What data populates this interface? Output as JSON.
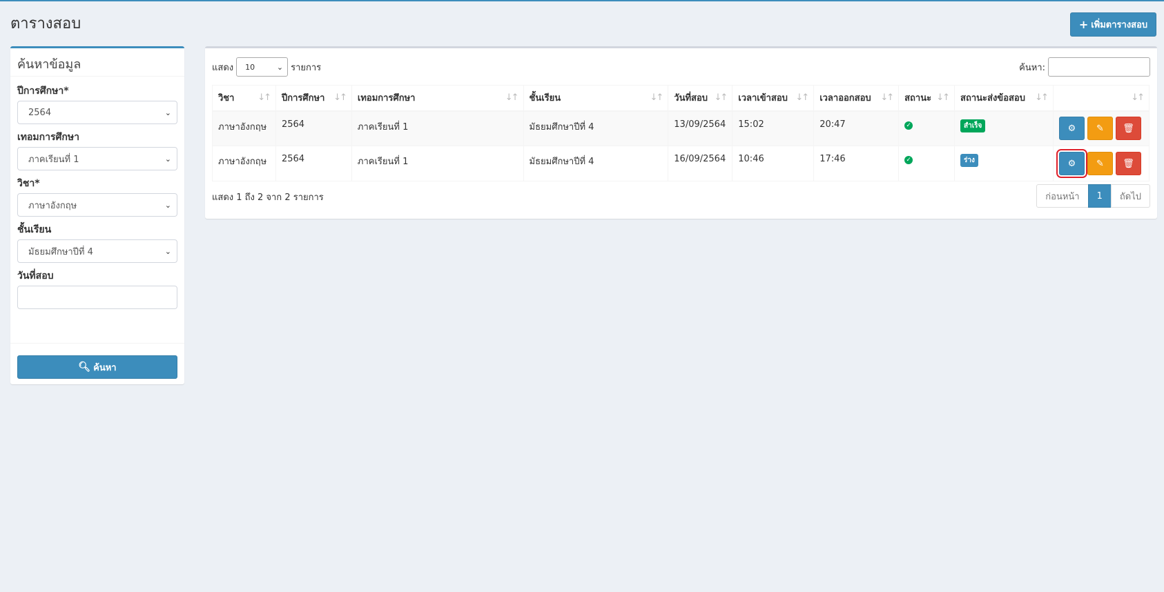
{
  "page": {
    "title": "ตารางสอบ",
    "add_button_label": "เพิ่มตารางสอบ"
  },
  "search_panel": {
    "title": "ค้นหาข้อมูล",
    "fields": {
      "year_label": "ปีการศึกษา*",
      "year_value": "2564",
      "term_label": "เทอมการศึกษา",
      "term_value": "ภาคเรียนที่ 1",
      "subject_label": "วิชา*",
      "subject_value": "ภาษาอังกฤษ",
      "level_label": "ชั้นเรียน",
      "level_value": "มัธยมศึกษาปีที่ 4",
      "date_label": "วันที่สอบ",
      "date_value": ""
    },
    "search_button_label": "ค้นหา"
  },
  "table": {
    "length_prefix": "แสดง",
    "length_value": "10",
    "length_suffix": "รายการ",
    "filter_label": "ค้นหา:",
    "filter_value": "",
    "columns": [
      "วิชา",
      "ปีการศึกษา",
      "เทอมการศึกษา",
      "ชั้นเรียน",
      "วันที่สอบ",
      "เวลาเข้าสอบ",
      "เวลาออกสอบ",
      "สถานะ",
      "สถานะส่งข้อสอบ",
      ""
    ],
    "rows": [
      {
        "subject": "ภาษาอังกฤษ",
        "year": "2564",
        "term": "ภาคเรียนที่ 1",
        "level": "มัธยมศึกษาปีที่ 4",
        "date": "13/09/2564",
        "time_in": "15:02",
        "time_out": "20:47",
        "status_icon": "check-circle-icon",
        "submit_status": "สำเร็จ",
        "submit_color": "#00a65a"
      },
      {
        "subject": "ภาษาอังกฤษ",
        "year": "2564",
        "term": "ภาคเรียนที่ 1",
        "level": "มัธยมศึกษาปีที่ 4",
        "date": "16/09/2564",
        "time_in": "10:46",
        "time_out": "17:46",
        "status_icon": "check-circle-icon",
        "submit_status": "ร่าง",
        "submit_color": "#3c8dbc"
      }
    ],
    "info_text": "แสดง 1 ถึง 2 จาก 2 รายการ",
    "pagination": {
      "prev": "ก่อนหน้า",
      "current": "1",
      "next": "ถัดไป"
    }
  },
  "colors": {
    "primary": "#3c8dbc",
    "warning": "#f39c12",
    "danger": "#dd4b39",
    "success": "#00a65a",
    "highlight": "#e0202a"
  }
}
